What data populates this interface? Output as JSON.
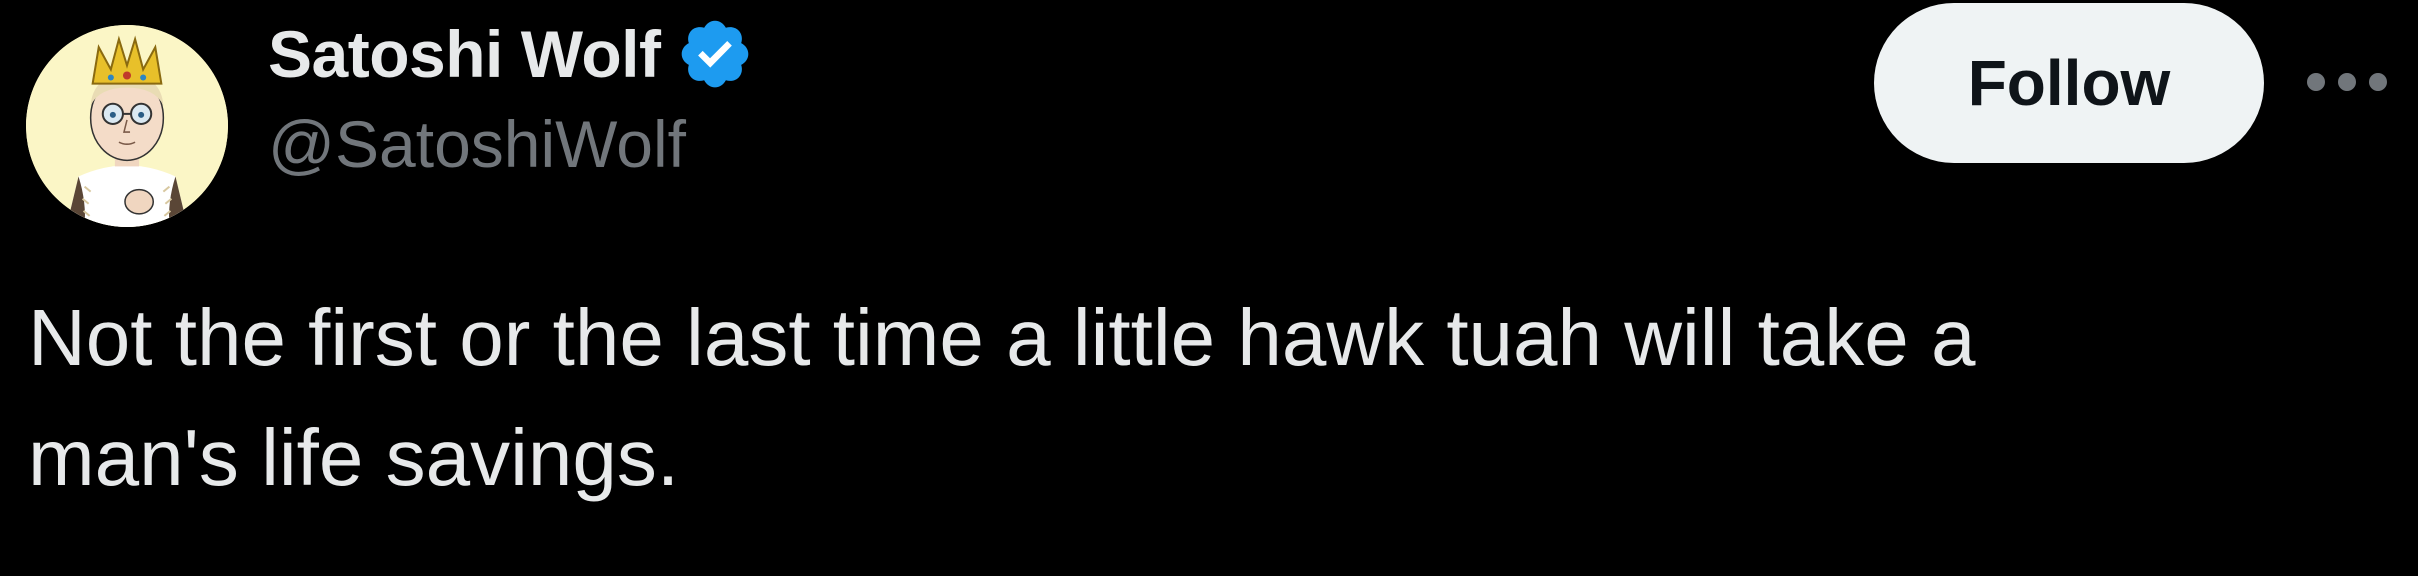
{
  "author": {
    "display_name": "Satoshi Wolf",
    "handle": "@SatoshiWolf",
    "verified": true,
    "verified_icon": "verified-badge-icon",
    "avatar": "cartoon-avatar-with-crown"
  },
  "actions": {
    "follow_label": "Follow",
    "more_icon": "more-options-icon"
  },
  "tweet": {
    "text": "Not the first or the last time a little hawk tuah will take a\nman's life savings."
  },
  "colors": {
    "background": "#000000",
    "primary_text": "#e7e9ea",
    "secondary_text": "#71767b",
    "follow_bg": "#eff3f4",
    "follow_text": "#0f1419",
    "verified_blue": "#1d9bf0"
  }
}
